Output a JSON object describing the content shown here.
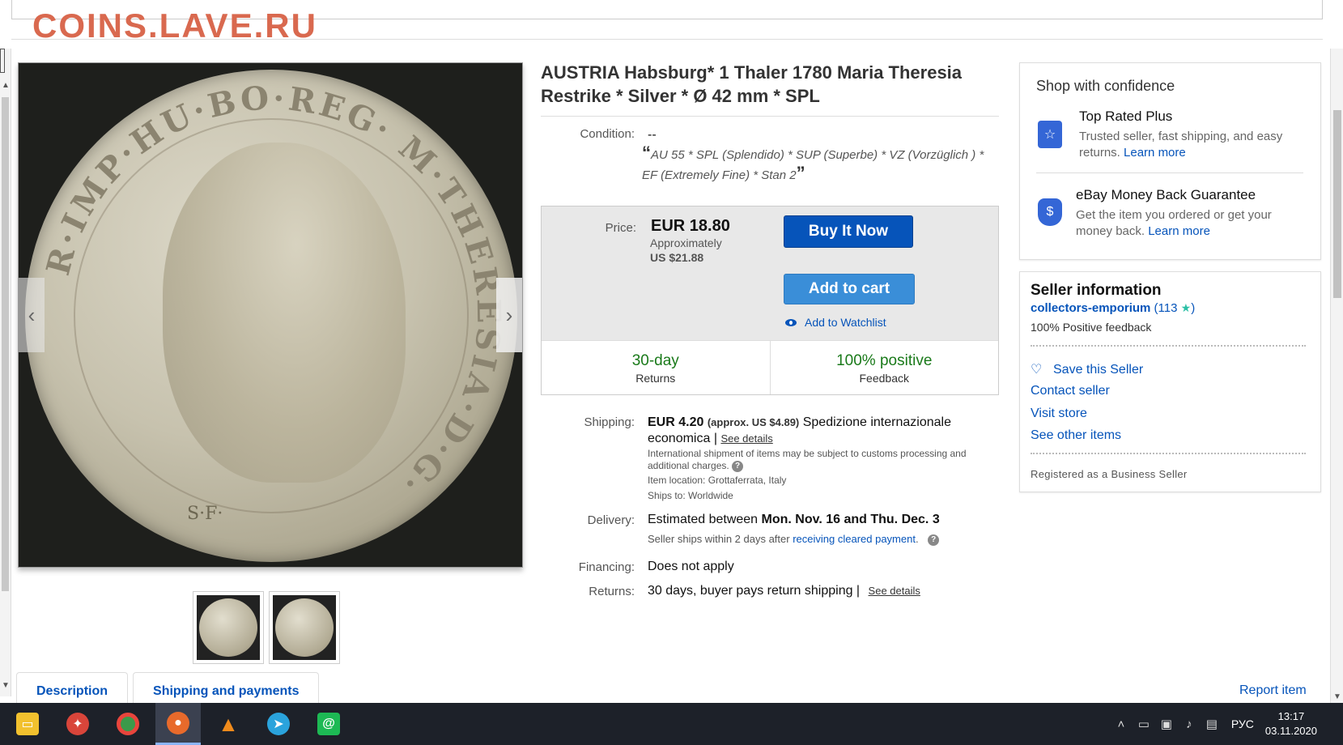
{
  "watermark": "COINS.LAVE.RU",
  "item": {
    "title": "AUSTRIA Habsburg* 1 Thaler 1780 Maria Theresia Restrike * Silver * Ø 42 mm * SPL",
    "condition_label": "Condition:",
    "condition_value": "--",
    "condition_note_open": "“",
    "condition_note": "AU 55 * SPL (Splendido) * SUP (Superbe) * VZ (Vorzüglich ) * EF (Extremely Fine) * Stan 2",
    "condition_note_close": "”",
    "coin_legend": "R·IMP·HU·BO·REG· M·THERESIA·D·G·",
    "mint_mark": "S·F·"
  },
  "pricing": {
    "label": "Price:",
    "price": "EUR 18.80",
    "approx": "Approximately",
    "usd": "US $21.88",
    "buy_now": "Buy It Now",
    "add_to_cart": "Add to cart",
    "watchlist": "Add to Watchlist",
    "stats": [
      {
        "big": "30-day",
        "small": "Returns"
      },
      {
        "big": "100% positive",
        "small": "Feedback"
      }
    ]
  },
  "shipping": {
    "label": "Shipping:",
    "price": "EUR 4.20",
    "approx": "(approx. US $4.89)",
    "method": "Spedizione internazionale economica |",
    "see_details": "See details",
    "intl_note": "International shipment of items may be subject to customs processing and additional charges.",
    "location": "Item location:  Grottaferrata, Italy",
    "ships_to": "Ships to:  Worldwide"
  },
  "delivery": {
    "label": "Delivery:",
    "prefix": "Estimated between ",
    "dates": "Mon. Nov. 16 and Thu. Dec. 3",
    "note_prefix": "Seller ships within 2 days after ",
    "note_link": "receiving cleared payment",
    "note_suffix": "."
  },
  "financing": {
    "label": "Financing:",
    "value": "Does not apply"
  },
  "returns": {
    "label": "Returns:",
    "value": "30 days, buyer pays return shipping |",
    "see_details": "See details"
  },
  "shop_confidence": {
    "heading": "Shop with confidence",
    "items": [
      {
        "title": "Top Rated Plus",
        "text": "Trusted seller, fast shipping, and easy returns.",
        "link": "Learn more",
        "icon": "star-badge-icon"
      },
      {
        "title": "eBay Money Back Guarantee",
        "text": "Get the item you ordered or get your money back.",
        "link": "Learn more",
        "icon": "dollar-shield-icon"
      }
    ]
  },
  "seller": {
    "heading": "Seller information",
    "name": "collectors-emporium",
    "feedback_open": "(113",
    "feedback_close": ")",
    "positive": "100% Positive feedback",
    "save": "Save this Seller",
    "contact": "Contact seller",
    "visit": "Visit store",
    "other": "See other items",
    "registered": "Registered as a Business Seller"
  },
  "tabs": [
    "Description",
    "Shipping and payments"
  ],
  "report": "Report item",
  "taskbar": {
    "apps": [
      {
        "name": "file-explorer-icon",
        "color": "#f2c12e"
      },
      {
        "name": "app-icon",
        "color": "#d9453a"
      },
      {
        "name": "chrome-icon",
        "color": "#3c9a4a"
      },
      {
        "name": "firefox-icon",
        "color": "#e86a2b"
      },
      {
        "name": "vlc-icon",
        "color": "#f08b1c"
      },
      {
        "name": "telegram-icon",
        "color": "#2aa3dc"
      },
      {
        "name": "mail-icon",
        "color": "#1db954"
      }
    ],
    "lang": "РУС",
    "time": "13:17",
    "date": "03.11.2020"
  }
}
